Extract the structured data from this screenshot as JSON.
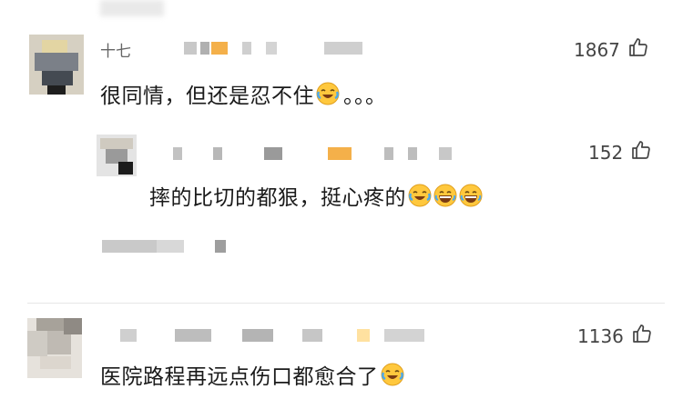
{
  "comments": [
    {
      "user": "十七",
      "likes": "1867",
      "text_before": "很同情，但还是忍不住",
      "text_after": "。。。"
    },
    {
      "likes": "152",
      "text_before": "摔的比切的都狠，挺心疼的"
    },
    {
      "likes": "1136",
      "text_before": "医院路程再远点伤口都愈合了"
    }
  ],
  "icons": {
    "like": "thumbs-up-icon",
    "laugh_cry": "laugh-cry-emoji",
    "grin_sweat": "grin-emoji"
  }
}
